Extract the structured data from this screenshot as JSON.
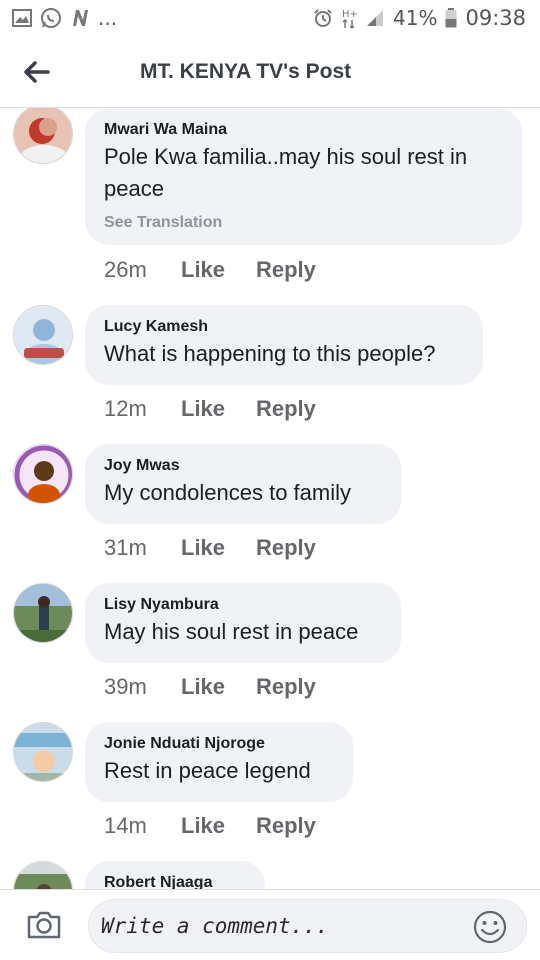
{
  "status_bar": {
    "left_icons": [
      "image-icon",
      "whatsapp-icon",
      "n-icon"
    ],
    "more": "...",
    "right_icons": [
      "alarm-icon",
      "network-icon",
      "signal-icon"
    ],
    "battery_percent": "41%",
    "time": "09:38"
  },
  "header": {
    "back_icon": "back-arrow-icon",
    "title": "MT. KENYA TV's Post"
  },
  "comments": [
    {
      "name": "Mwari Wa Maina",
      "text_lines": [
        "Pole Kwa familia..may his soul rest in",
        "peace"
      ],
      "translation": "See Translation",
      "time": "26m",
      "like": "Like",
      "reply": "Reply",
      "avatar_colors": [
        "#c0392b",
        "#e8b4a8"
      ]
    },
    {
      "name": "Lucy Kamesh",
      "text_lines": [
        "What is happening to this people?"
      ],
      "time": "12m",
      "like": "Like",
      "reply": "Reply",
      "avatar_colors": [
        "#8fb5d8",
        "#c0392b"
      ]
    },
    {
      "name": "Joy Mwas",
      "text_lines": [
        "My condolences to family"
      ],
      "time": "31m",
      "like": "Like",
      "reply": "Reply",
      "avatar_colors": [
        "#9b59b6",
        "#d35400"
      ]
    },
    {
      "name": "Lisy Nyambura",
      "text_lines": [
        "May his soul rest in peace"
      ],
      "time": "39m",
      "like": "Like",
      "reply": "Reply",
      "avatar_colors": [
        "#4a6b3a",
        "#2c3e50"
      ]
    },
    {
      "name": "Jonie Nduati Njoroge",
      "text_lines": [
        "Rest in peace legend"
      ],
      "time": "14m",
      "like": "Like",
      "reply": "Reply",
      "avatar_colors": [
        "#7fb3d5",
        "#f5cba7"
      ]
    },
    {
      "name": "Robert Njaaga",
      "text_lines": [],
      "avatar_colors": [
        "#6c8a5a",
        "#d5dbdb"
      ]
    }
  ],
  "composer": {
    "camera_icon": "camera-icon",
    "placeholder": "Write a comment...",
    "emoji_icon": "smiley-icon"
  },
  "colors": {
    "bubble": "#f0f2f5",
    "meta_text": "#65676b",
    "title_text": "#3b4046"
  }
}
